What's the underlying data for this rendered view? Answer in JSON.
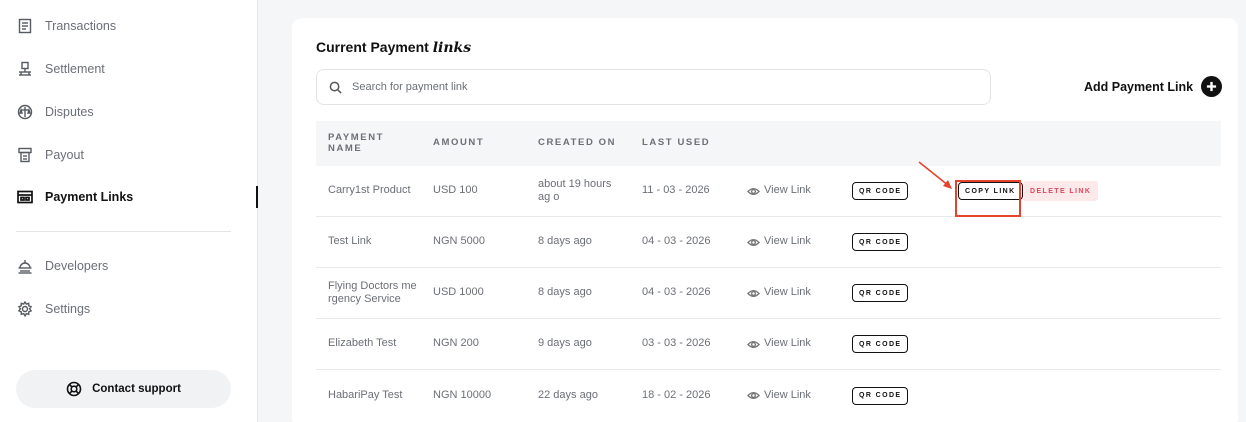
{
  "sidebar": {
    "items": [
      {
        "label": "Transactions",
        "icon": "receipt-icon"
      },
      {
        "label": "Settlement",
        "icon": "bank-icon"
      },
      {
        "label": "Disputes",
        "icon": "disputes-icon"
      },
      {
        "label": "Payout",
        "icon": "payout-icon"
      },
      {
        "label": "Payment Links",
        "icon": "link-card-icon",
        "active": true
      },
      {
        "label": "Developers",
        "icon": "developers-icon"
      },
      {
        "label": "Settings",
        "icon": "gear-icon"
      }
    ],
    "support_label": "Contact support"
  },
  "main": {
    "title_prefix": "Current Payment",
    "title_italic": "links",
    "search_placeholder": "Search for payment link",
    "add_label": "Add Payment Link",
    "columns": [
      "PAYMENT NAME",
      "AMOUNT",
      "CREATED ON",
      "LAST USED"
    ],
    "view_link_label": "View Link",
    "qr_label": "QR CODE",
    "copy_label": "COPY LINK",
    "delete_label": "DELETE LINK",
    "rows": [
      {
        "name": "Carry1st Product",
        "amount": "USD 100",
        "created": "about 19 hours ag o",
        "last_used": "11 - 03 - 2026"
      },
      {
        "name": "Test Link",
        "amount": "NGN 5000",
        "created": "8 days ago",
        "last_used": "04 - 03 - 2026"
      },
      {
        "name": "Flying Doctors me rgency Service",
        "amount": "USD 1000",
        "created": "8 days ago",
        "last_used": "04 - 03 - 2026"
      },
      {
        "name": "Elizabeth Test",
        "amount": "NGN 200",
        "created": "9 days ago",
        "last_used": "03 - 03 - 2026"
      },
      {
        "name": "HabariPay Test",
        "amount": "NGN 10000",
        "created": "22 days ago",
        "last_used": "18 - 02 - 2026"
      }
    ]
  },
  "colors": {
    "accent_dark": "#111111",
    "delete_text": "#e2455a",
    "delete_bg": "#fde8ea",
    "annotation_red": "#e5432d"
  }
}
